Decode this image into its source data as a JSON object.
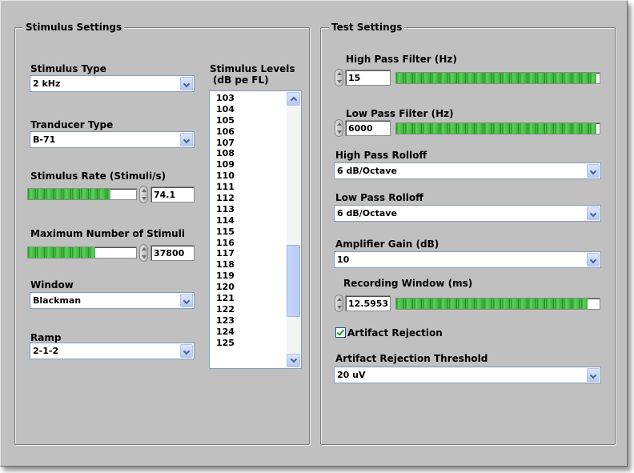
{
  "stimulus_settings": {
    "title": "Stimulus Settings",
    "stimulus_type": {
      "label": "Stimulus Type",
      "value": "2 kHz"
    },
    "transducer_type": {
      "label": "Tranducer Type",
      "value": "B-71"
    },
    "stimulus_rate": {
      "label": "Stimulus Rate (Stimuli/s)",
      "value": "74.1",
      "fill_fraction": 0.76
    },
    "max_stimuli": {
      "label": "Maximum Number of Stimuli",
      "value": "37800",
      "fill_fraction": 0.62
    },
    "window": {
      "label": "Window",
      "value": "Blackman"
    },
    "ramp": {
      "label": "Ramp",
      "value": "2-1-2"
    },
    "levels": {
      "label_line1": "Stimulus Levels",
      "label_line2": "(dB pe FL)",
      "items": [
        "103",
        "104",
        "105",
        "106",
        "107",
        "108",
        "109",
        "110",
        "111",
        "112",
        "113",
        "114",
        "115",
        "116",
        "117",
        "118",
        "119",
        "120",
        "121",
        "122",
        "123",
        "124",
        "125"
      ],
      "scroll_position_fraction": 0.79
    }
  },
  "test_settings": {
    "title": "Test Settings",
    "high_pass_filter": {
      "label": "High Pass Filter (Hz)",
      "value": "15",
      "fill_fraction": 0.985
    },
    "low_pass_filter": {
      "label": "Low Pass Filter (Hz)",
      "value": "6000",
      "fill_fraction": 0.985
    },
    "high_pass_rolloff": {
      "label": "High Pass Rolloff",
      "value": "6 dB/Octave"
    },
    "low_pass_rolloff": {
      "label": "Low Pass Rolloff",
      "value": "6 dB/Octave"
    },
    "amplifier_gain": {
      "label": "Amplifier Gain (dB)",
      "value": "10"
    },
    "recording_window": {
      "label": "Recording Window (ms)",
      "value": "12.5953",
      "fill_fraction": 0.94
    },
    "artifact_rejection": {
      "label": "Artifact Rejection",
      "checked": true
    },
    "artifact_threshold": {
      "label": "Artifact Rejection Threshold",
      "value": "20 uV"
    }
  },
  "colors": {
    "panel_bg": "#c0c0c0",
    "slider_fill": "#2fb02f",
    "combo_border": "#7f9db9"
  }
}
